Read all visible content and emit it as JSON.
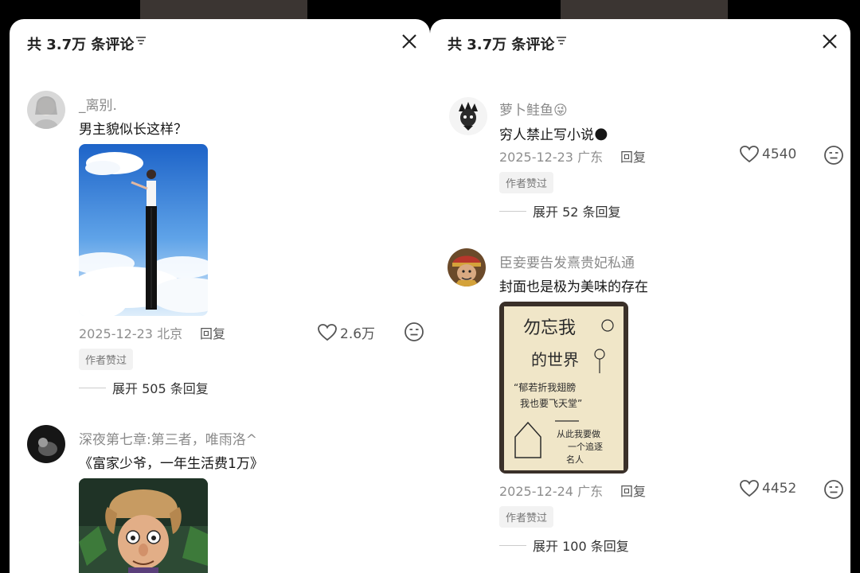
{
  "left": {
    "header": {
      "title": "共 3.7万 条评论"
    },
    "comments": [
      {
        "username": "_离别.",
        "text": "男主貌似长这样？",
        "date_loc": "2025-12-23 北京",
        "reply": "回复",
        "likes": "2.6万",
        "badge": "作者赞过",
        "expand": "展开 505 条回复",
        "image_caption": "男士长腿站在云上"
      },
      {
        "username": "深夜第七章:第三者，唯雨洛^",
        "text": "《富家少爷，一年生活费1万》",
        "image_caption": "熊出没光头强"
      }
    ]
  },
  "right": {
    "header": {
      "title": "共 3.7万 条评论"
    },
    "comments": [
      {
        "username": "萝卜鲑鱼",
        "emoji": "😜",
        "text": "穷人禁止写小说",
        "text_emoji": "🌑",
        "date_loc": "2025-12-23 广东",
        "reply": "回复",
        "likes": "4540",
        "badge": "作者赞过",
        "expand": "展开 52 条回复"
      },
      {
        "username": "臣妾要告发熹贵妃私通",
        "text": "封面也是极为美味的存在",
        "date_loc": "2025-12-24 广东",
        "reply": "回复",
        "likes": "4452",
        "badge": "作者赞过",
        "expand": "展开 100 条回复",
        "image_lines": [
          "勿忘我",
          "的世界",
          "“郁若折我翅膀",
          "我也要飞天堂”",
          "从此我要做",
          "一个追逐",
          "名人"
        ]
      }
    ]
  },
  "colors": {
    "panel": "#ffffff",
    "text": "#161616",
    "muted": "#8e8e8e",
    "badge_bg": "#f2f2f2"
  }
}
